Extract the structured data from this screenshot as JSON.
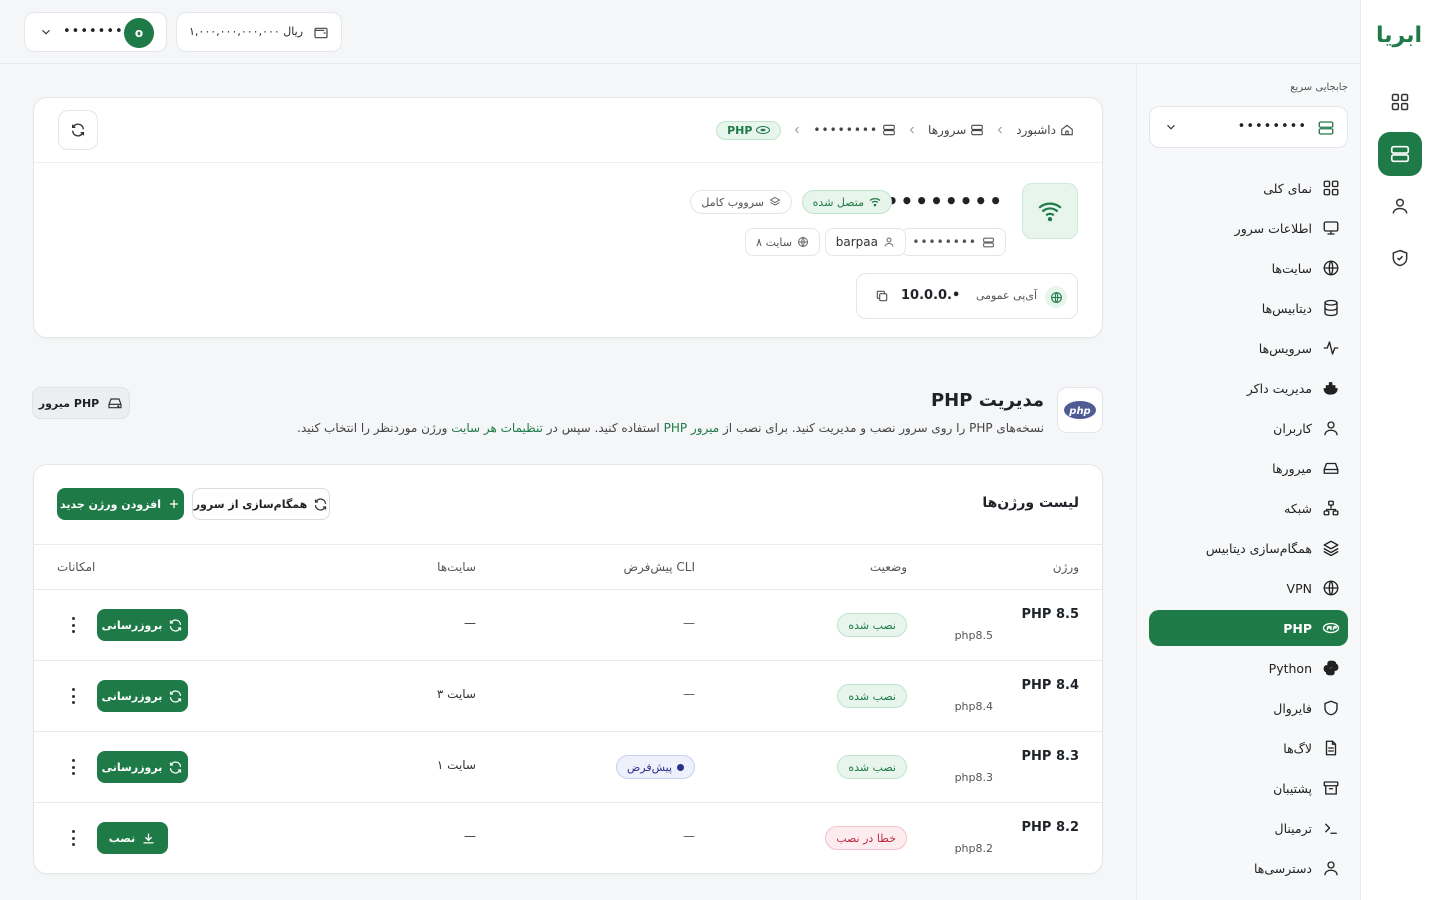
{
  "topbar": {
    "account_name": "••••••••",
    "avatar_letter": "o",
    "balance": "۱,۰۰۰,۰۰۰,۰۰۰,۰۰۰ ریال"
  },
  "rail": {
    "brand": "ابریا",
    "items": [
      "grid-icon",
      "server-icon",
      "user-icon",
      "shield-check-icon"
    ],
    "active_index": 1
  },
  "sidebar": {
    "quick_label": "جابجایی سریع",
    "quick_value": "••••••••",
    "items": [
      {
        "label": "نمای کلی",
        "icon": "grid-icon"
      },
      {
        "label": "اطلاعات سرور",
        "icon": "monitor-icon"
      },
      {
        "label": "سایت‌ها",
        "icon": "globe-icon"
      },
      {
        "label": "دیتابیس‌ها",
        "icon": "database-icon"
      },
      {
        "label": "سرویس‌ها",
        "icon": "activity-icon"
      },
      {
        "label": "مدیریت داکر",
        "icon": "docker-icon"
      },
      {
        "label": "کاربران",
        "icon": "user-icon"
      },
      {
        "label": "میرورها",
        "icon": "hard-drive-icon"
      },
      {
        "label": "شبکه",
        "icon": "network-icon"
      },
      {
        "label": "همگام‌سازی دیتابیس",
        "icon": "layers-icon"
      },
      {
        "label": "VPN",
        "icon": "globe-lock-icon"
      },
      {
        "label": "PHP",
        "icon": "php-icon"
      },
      {
        "label": "Python",
        "icon": "python-icon"
      },
      {
        "label": "فایروال",
        "icon": "shield-icon"
      },
      {
        "label": "لاگ‌ها",
        "icon": "file-text-icon"
      },
      {
        "label": "پشتیبان",
        "icon": "archive-icon"
      },
      {
        "label": "ترمینال",
        "icon": "terminal-icon"
      },
      {
        "label": "دسترسی‌ها",
        "icon": "user-key-icon"
      }
    ],
    "active_index": 11
  },
  "breadcrumb": {
    "home": "داشبورد",
    "servers": "سرورها",
    "server": "••••••••",
    "current": "PHP"
  },
  "server": {
    "name": "••••••••",
    "status": "متصل شده",
    "type": "سرووب کامل",
    "host": "••••••••",
    "user": "barpaa",
    "sites": "۸ سایت",
    "ip_label": "آی‌پی عمومی",
    "ip_value": "10.0.0.•"
  },
  "php_section": {
    "title": "مدیریت PHP",
    "desc_1": "نسخه‌های PHP را روی سرور نصب و مدیریت کنید. برای نصب از",
    "desc_link1": "میرور PHP",
    "desc_2": "استفاده کنید. سپس در",
    "desc_link2": "تنظیمات هر سایت",
    "desc_3": "ورژن موردنظر را انتخاب کنید.",
    "mirror_button": "میرور PHP",
    "php_logo_text": "php"
  },
  "versions": {
    "title": "لیست ورژن‌ها",
    "sync_button": "همگام‌سازی از سرور",
    "add_button": "افزودن ورژن جدید",
    "headers": {
      "version": "ورژن",
      "status": "وضعیت",
      "cli": "پیش‌فرض CLI",
      "sites": "سایت‌ها",
      "actions": "امکانات"
    },
    "rows": [
      {
        "name": "PHP 8.5",
        "id": "php8.5",
        "status": "نصب شده",
        "status_kind": "ok",
        "cli": "—",
        "sites": "—",
        "action": "بروزرسانی"
      },
      {
        "name": "PHP 8.4",
        "id": "php8.4",
        "status": "نصب شده",
        "status_kind": "ok",
        "cli": "—",
        "sites": "۳ سایت",
        "action": "بروزرسانی"
      },
      {
        "name": "PHP 8.3",
        "id": "php8.3",
        "status": "نصب شده",
        "status_kind": "ok",
        "cli": "پیش‌فرض",
        "sites": "۱ سایت",
        "action": "بروزرسانی"
      },
      {
        "name": "PHP 8.2",
        "id": "php8.2",
        "status": "خطا در نصب",
        "status_kind": "error",
        "cli": "—",
        "sites": "—",
        "action": "نصب"
      }
    ]
  },
  "colors": {
    "primary": "#1e7a46",
    "error": "#c0283f",
    "default_badge": "#2b2f8a"
  }
}
